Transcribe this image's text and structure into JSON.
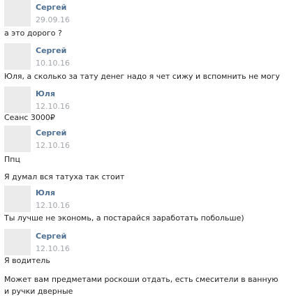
{
  "messages": [
    {
      "author": "Сергей",
      "date": "29.09.16",
      "texts": [
        "а это дорого ?"
      ]
    },
    {
      "author": "Сергей",
      "date": "10.10.16",
      "texts": [
        "Юля, а сколько за тату денег надо я чет сижу и вспомнить не могу"
      ]
    },
    {
      "author": "Юля",
      "date": "12.10.16",
      "texts": [
        "Сеанс 3000₽"
      ]
    },
    {
      "author": "Сергей",
      "date": "12.10.16",
      "texts": [
        "Ппц",
        "Я думал вся татуха так стоит"
      ]
    },
    {
      "author": "Юля",
      "date": "12.10.16",
      "texts": [
        "Ты лучше не экономь, а постарайся заработать побольше)"
      ]
    },
    {
      "author": "Сергей",
      "date": "12.10.16",
      "texts": [
        "Я водитель",
        "Может вам предметами роскоши отдать, есть смесители в ванную и ручки дверные"
      ]
    }
  ],
  "colors": {
    "author": "#4f6f92",
    "date": "#a3a7ab",
    "text": "#222222",
    "avatar": "#ebebeb"
  }
}
